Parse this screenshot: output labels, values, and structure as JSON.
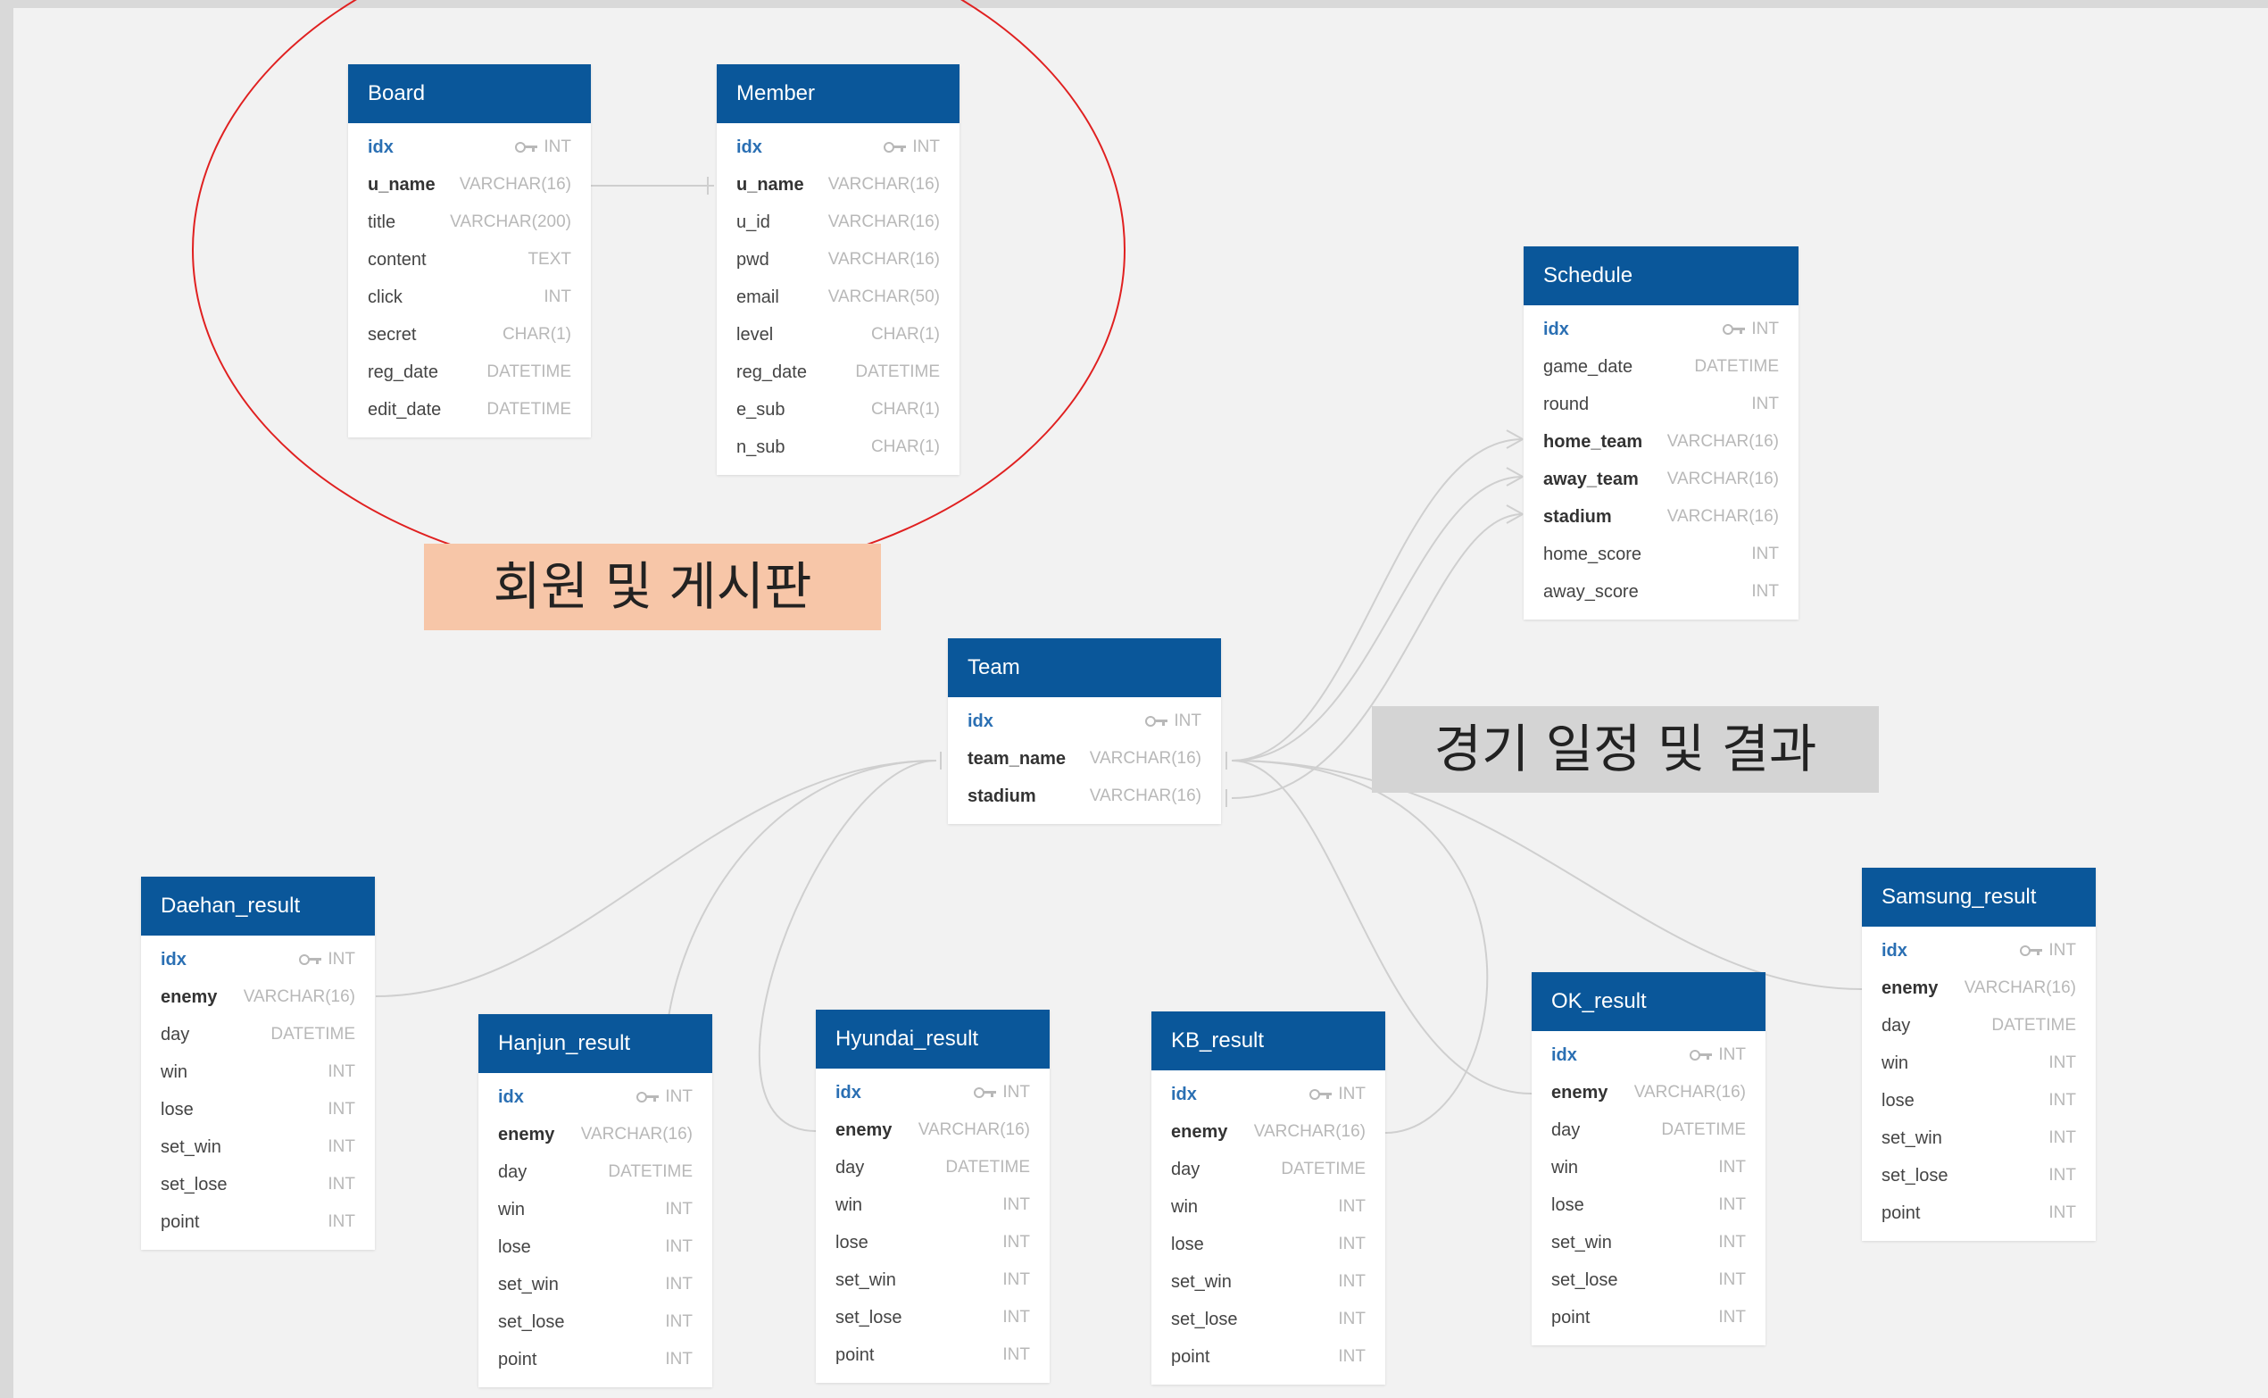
{
  "callouts": {
    "member_board": "회원 및 게시판",
    "schedule_results": "경기 일정 및 결과"
  },
  "colors": {
    "table_header": "#0a579a",
    "circle": "#e02020",
    "callout_member_bg": "#f7c6a8",
    "callout_schedule_bg": "#d4d4d4"
  },
  "tables": {
    "board": {
      "name": "Board",
      "fields": [
        {
          "name": "idx",
          "type": "INT",
          "pk": true
        },
        {
          "name": "u_name",
          "type": "VARCHAR(16)",
          "bold": true
        },
        {
          "name": "title",
          "type": "VARCHAR(200)"
        },
        {
          "name": "content",
          "type": "TEXT"
        },
        {
          "name": "click",
          "type": "INT"
        },
        {
          "name": "secret",
          "type": "CHAR(1)"
        },
        {
          "name": "reg_date",
          "type": "DATETIME"
        },
        {
          "name": "edit_date",
          "type": "DATETIME"
        }
      ]
    },
    "member": {
      "name": "Member",
      "fields": [
        {
          "name": "idx",
          "type": "INT",
          "pk": true
        },
        {
          "name": "u_name",
          "type": "VARCHAR(16)",
          "bold": true
        },
        {
          "name": "u_id",
          "type": "VARCHAR(16)"
        },
        {
          "name": "pwd",
          "type": "VARCHAR(16)"
        },
        {
          "name": "email",
          "type": "VARCHAR(50)"
        },
        {
          "name": "level",
          "type": "CHAR(1)"
        },
        {
          "name": "reg_date",
          "type": "DATETIME"
        },
        {
          "name": "e_sub",
          "type": "CHAR(1)"
        },
        {
          "name": "n_sub",
          "type": "CHAR(1)"
        }
      ]
    },
    "schedule": {
      "name": "Schedule",
      "fields": [
        {
          "name": "idx",
          "type": "INT",
          "pk": true
        },
        {
          "name": "game_date",
          "type": "DATETIME"
        },
        {
          "name": "round",
          "type": "INT"
        },
        {
          "name": "home_team",
          "type": "VARCHAR(16)",
          "bold": true
        },
        {
          "name": "away_team",
          "type": "VARCHAR(16)",
          "bold": true
        },
        {
          "name": "stadium",
          "type": "VARCHAR(16)",
          "bold": true
        },
        {
          "name": "home_score",
          "type": "INT"
        },
        {
          "name": "away_score",
          "type": "INT"
        }
      ]
    },
    "team": {
      "name": "Team",
      "fields": [
        {
          "name": "idx",
          "type": "INT",
          "pk": true
        },
        {
          "name": "team_name",
          "type": "VARCHAR(16)",
          "bold": true
        },
        {
          "name": "stadium",
          "type": "VARCHAR(16)",
          "bold": true
        }
      ]
    },
    "daehan": {
      "name": "Daehan_result",
      "fields": [
        {
          "name": "idx",
          "type": "INT",
          "pk": true
        },
        {
          "name": "enemy",
          "type": "VARCHAR(16)",
          "bold": true
        },
        {
          "name": "day",
          "type": "DATETIME"
        },
        {
          "name": "win",
          "type": "INT"
        },
        {
          "name": "lose",
          "type": "INT"
        },
        {
          "name": "set_win",
          "type": "INT"
        },
        {
          "name": "set_lose",
          "type": "INT"
        },
        {
          "name": "point",
          "type": "INT"
        }
      ]
    },
    "hanjun": {
      "name": "Hanjun_result",
      "fields": [
        {
          "name": "idx",
          "type": "INT",
          "pk": true
        },
        {
          "name": "enemy",
          "type": "VARCHAR(16)",
          "bold": true
        },
        {
          "name": "day",
          "type": "DATETIME"
        },
        {
          "name": "win",
          "type": "INT"
        },
        {
          "name": "lose",
          "type": "INT"
        },
        {
          "name": "set_win",
          "type": "INT"
        },
        {
          "name": "set_lose",
          "type": "INT"
        },
        {
          "name": "point",
          "type": "INT"
        }
      ]
    },
    "hyundai": {
      "name": "Hyundai_result",
      "fields": [
        {
          "name": "idx",
          "type": "INT",
          "pk": true
        },
        {
          "name": "enemy",
          "type": "VARCHAR(16)",
          "bold": true
        },
        {
          "name": "day",
          "type": "DATETIME"
        },
        {
          "name": "win",
          "type": "INT"
        },
        {
          "name": "lose",
          "type": "INT"
        },
        {
          "name": "set_win",
          "type": "INT"
        },
        {
          "name": "set_lose",
          "type": "INT"
        },
        {
          "name": "point",
          "type": "INT"
        }
      ]
    },
    "kb": {
      "name": "KB_result",
      "fields": [
        {
          "name": "idx",
          "type": "INT",
          "pk": true
        },
        {
          "name": "enemy",
          "type": "VARCHAR(16)",
          "bold": true
        },
        {
          "name": "day",
          "type": "DATETIME"
        },
        {
          "name": "win",
          "type": "INT"
        },
        {
          "name": "lose",
          "type": "INT"
        },
        {
          "name": "set_win",
          "type": "INT"
        },
        {
          "name": "set_lose",
          "type": "INT"
        },
        {
          "name": "point",
          "type": "INT"
        }
      ]
    },
    "ok": {
      "name": "OK_result",
      "fields": [
        {
          "name": "idx",
          "type": "INT",
          "pk": true
        },
        {
          "name": "enemy",
          "type": "VARCHAR(16)",
          "bold": true
        },
        {
          "name": "day",
          "type": "DATETIME"
        },
        {
          "name": "win",
          "type": "INT"
        },
        {
          "name": "lose",
          "type": "INT"
        },
        {
          "name": "set_win",
          "type": "INT"
        },
        {
          "name": "set_lose",
          "type": "INT"
        },
        {
          "name": "point",
          "type": "INT"
        }
      ]
    },
    "samsung": {
      "name": "Samsung_result",
      "fields": [
        {
          "name": "idx",
          "type": "INT",
          "pk": true
        },
        {
          "name": "enemy",
          "type": "VARCHAR(16)",
          "bold": true
        },
        {
          "name": "day",
          "type": "DATETIME"
        },
        {
          "name": "win",
          "type": "INT"
        },
        {
          "name": "lose",
          "type": "INT"
        },
        {
          "name": "set_win",
          "type": "INT"
        },
        {
          "name": "set_lose",
          "type": "INT"
        },
        {
          "name": "point",
          "type": "INT"
        }
      ]
    }
  }
}
